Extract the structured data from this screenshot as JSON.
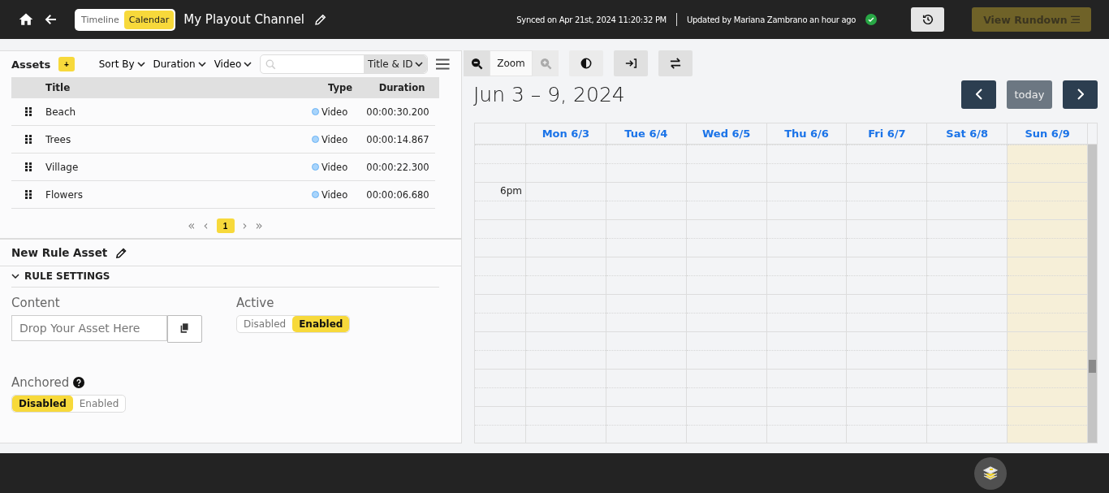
{
  "header": {
    "view_tabs": [
      {
        "label": "Timeline",
        "selected": false
      },
      {
        "label": "Calendar",
        "selected": true
      }
    ],
    "channel_title": "My Playout Channel",
    "sync_status": "Synced on Apr 21st, 2024 11:20:32 PM",
    "update_status": "Updated by Mariana Zambrano an hour ago",
    "view_rundown_button": "View Rundown"
  },
  "assets": {
    "title": "Assets",
    "add_button": "+",
    "filters": [
      "Sort By",
      "Duration",
      "Video"
    ],
    "search": {
      "scope": "Title & ID"
    },
    "table": {
      "columns": [
        "Title",
        "Type",
        "Duration"
      ],
      "rows": [
        {
          "title": "Beach",
          "type": "Video",
          "duration": "00:00:30.200"
        },
        {
          "title": "Trees",
          "type": "Video",
          "duration": "00:00:14.867"
        },
        {
          "title": "Village",
          "type": "Video",
          "duration": "00:00:22.300"
        },
        {
          "title": "Flowers",
          "type": "Video",
          "duration": "00:00:06.680"
        }
      ]
    },
    "pager": {
      "first": "«",
      "previous": "‹",
      "next": "›",
      "last": "»"
    },
    "pages": [
      {
        "label": "1",
        "selected": true
      }
    ]
  },
  "rule": {
    "title": "New Rule Asset",
    "section": "RULE SETTINGS",
    "expanded": true,
    "content": {
      "label": "Content",
      "placeholder": "Drop Your Asset Here"
    },
    "active": {
      "label": "Active",
      "options": [
        {
          "label": "Disabled",
          "selected": false
        },
        {
          "label": "Enabled",
          "selected": true
        }
      ]
    },
    "anchored": {
      "label": "Anchored",
      "options": [
        {
          "label": "Disabled",
          "selected": true
        },
        {
          "label": "Enabled",
          "selected": false
        }
      ]
    }
  },
  "calendar": {
    "zoom_label": "Zoom",
    "range": "Jun 3 – 9, 2024",
    "today_button": "today",
    "days": [
      {
        "label": "Mon 6/3",
        "today": false
      },
      {
        "label": "Tue 6/4",
        "today": false
      },
      {
        "label": "Wed 6/5",
        "today": false
      },
      {
        "label": "Thu 6/6",
        "today": false
      },
      {
        "label": "Fri 6/7",
        "today": false
      },
      {
        "label": "Sat 6/8",
        "today": false
      },
      {
        "label": "Sun 6/9",
        "today": true
      }
    ],
    "hours": [
      {
        "label": "6pm"
      }
    ]
  }
}
